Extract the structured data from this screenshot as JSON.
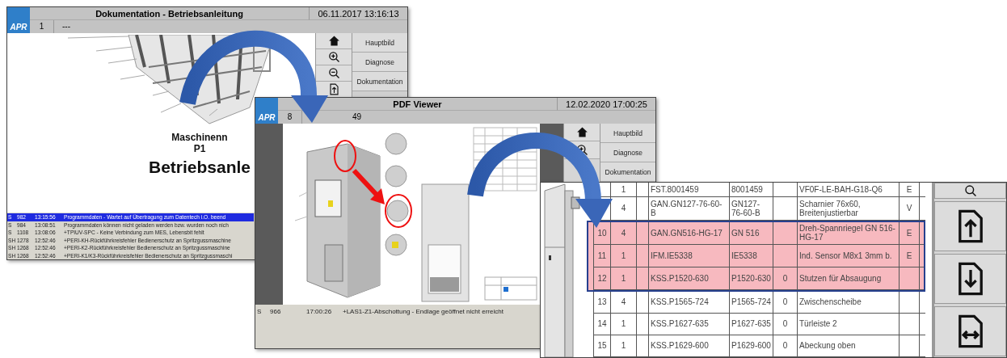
{
  "windows": [
    {
      "kind": "hmi",
      "logo": "APR",
      "title": "Dokumentation - Betriebsanleitung",
      "datetime": "06.11.2017 13:16:13",
      "page": "1",
      "page_count": "---",
      "document": {
        "kind": "title_page",
        "lines": [
          "Maschinenn",
          "P1",
          "Betriebsanle"
        ]
      },
      "nav_buttons": [
        "Hauptbild",
        "Diagnose",
        "Dokumentation"
      ],
      "alarms": [
        {
          "category": "S",
          "number": "982",
          "time": "13:15:56",
          "text": "Programmdaten - Wartet auf Übertragung zum Datentech i.O. beend",
          "selected": true
        },
        {
          "category": "S",
          "number": "984",
          "time": "13:08:51",
          "text": "Programmdaten können nicht geladen werden bzw. wurden noch nich",
          "selected": false
        },
        {
          "category": "S",
          "number": "1108",
          "time": "13:08:06",
          "text": "+TPIUV-SPC - Keine Verbindung zum MES, Lebensbit fehlt",
          "selected": false
        },
        {
          "category": "SH",
          "number": "1278",
          "time": "12:52:46",
          "text": "+PERI-KH-Rückführkreisfehler Bedienerschutz an Spritzgussmaschine",
          "selected": false
        },
        {
          "category": "SH",
          "number": "1268",
          "time": "12:52:46",
          "text": "+PERI-K2-Rückführkreisfehler Bedienerschutz an Spritzgussmaschine",
          "selected": false
        },
        {
          "category": "SH",
          "number": "1268",
          "time": "12:52:46",
          "text": "+PERI-K1/K3-Rückführkreisfehler Bedienerschutz an Spritzgussmaschi",
          "selected": false
        }
      ]
    },
    {
      "kind": "hmi",
      "logo": "APR",
      "title": "PDF Viewer",
      "datetime": "12.02.2020 17:00:25",
      "page": "8",
      "page_count": "49",
      "document": {
        "kind": "drawing"
      },
      "nav_buttons": [
        "Hauptbild",
        "Diagnose",
        "Dokumentation"
      ],
      "alarms": [
        {
          "category": "S",
          "number": "966",
          "time": "17:00:26",
          "text": "+LAS1-Z1-Abschottung - Endlage geöffnet nicht erreicht",
          "selected": false
        }
      ]
    },
    {
      "kind": "detail",
      "table": {
        "rows": [
          {
            "cells": [
              "",
              "1",
              "",
              "FST.8001459",
              "8001459",
              "",
              "VF0F-LE-BAH-G18-Q6",
              "E"
            ],
            "highlighted": false
          },
          {
            "cells": [
              "",
              "4",
              "",
              "GAN.GN127-76-60-B",
              "GN127-76-60-B",
              "",
              "Scharnier 76x60, Breitenjustierbar",
              "V"
            ],
            "highlighted": false
          },
          {
            "cells": [
              "10",
              "4",
              "",
              "GAN.GN516-HG-17",
              "GN 516",
              "",
              "Dreh-Spannriegel GN 516-HG-17",
              "E"
            ],
            "highlighted": true
          },
          {
            "cells": [
              "11",
              "1",
              "",
              "IFM.IE5338",
              "IE5338",
              "",
              "Ind. Sensor M8x1 3mm b.",
              "E"
            ],
            "highlighted": true
          },
          {
            "cells": [
              "12",
              "1",
              "",
              "KSS.P1520-630",
              "P1520-630",
              "0",
              "Stutzen für Absaugung",
              ""
            ],
            "highlighted": true
          },
          {
            "cells": [
              "13",
              "4",
              "",
              "KSS.P1565-724",
              "P1565-724",
              "0",
              "Zwischenscheibe",
              ""
            ],
            "highlighted": false
          },
          {
            "cells": [
              "14",
              "1",
              "",
              "KSS.P1627-635",
              "P1627-635",
              "0",
              "Türleiste 2",
              ""
            ],
            "highlighted": false
          },
          {
            "cells": [
              "15",
              "1",
              "",
              "KSS.P1629-600",
              "P1629-600",
              "0",
              "Abeckung oben",
              ""
            ],
            "highlighted": false
          }
        ]
      }
    }
  ]
}
